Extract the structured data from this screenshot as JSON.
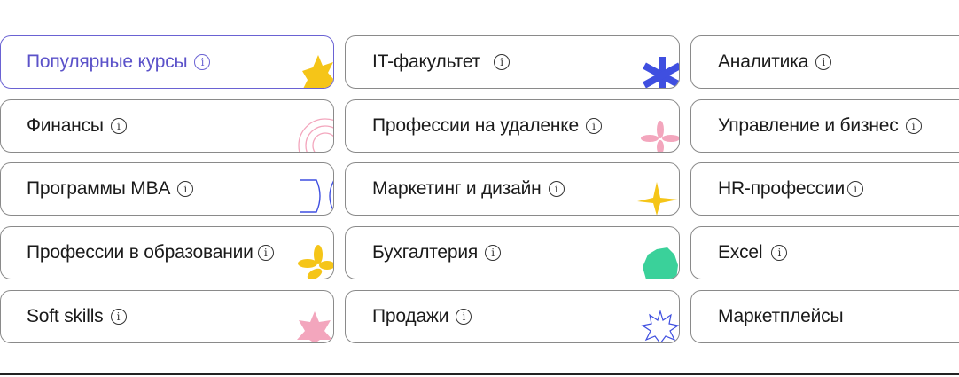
{
  "categories": [
    {
      "label": "Популярные курсы",
      "info": "i"
    },
    {
      "label": "IT-факультет",
      "info": "i"
    },
    {
      "label": "Аналитика",
      "info": "i"
    },
    {
      "label": "Финансы",
      "info": "i"
    },
    {
      "label": "Профессии на удаленке",
      "info": "i"
    },
    {
      "label": "Управление и бизнес",
      "info": "i"
    },
    {
      "label": "Программы MBA",
      "info": "i"
    },
    {
      "label": "Маркетинг и дизайн",
      "info": "i"
    },
    {
      "label": "HR-профессии",
      "info": "i"
    },
    {
      "label": "Профессии в образовании",
      "info": "i"
    },
    {
      "label": "Бухгалтерия",
      "info": "i"
    },
    {
      "label": "Excel",
      "info": "i"
    },
    {
      "label": "Soft skills",
      "info": "i"
    },
    {
      "label": "Продажи",
      "info": "i"
    },
    {
      "label": "Маркетплейсы"
    }
  ],
  "colors": {
    "accent": "#5b52c9",
    "yellow": "#f5c518",
    "blue": "#3f4fe0",
    "pink": "#f3a6bd",
    "green": "#3ad19a"
  }
}
